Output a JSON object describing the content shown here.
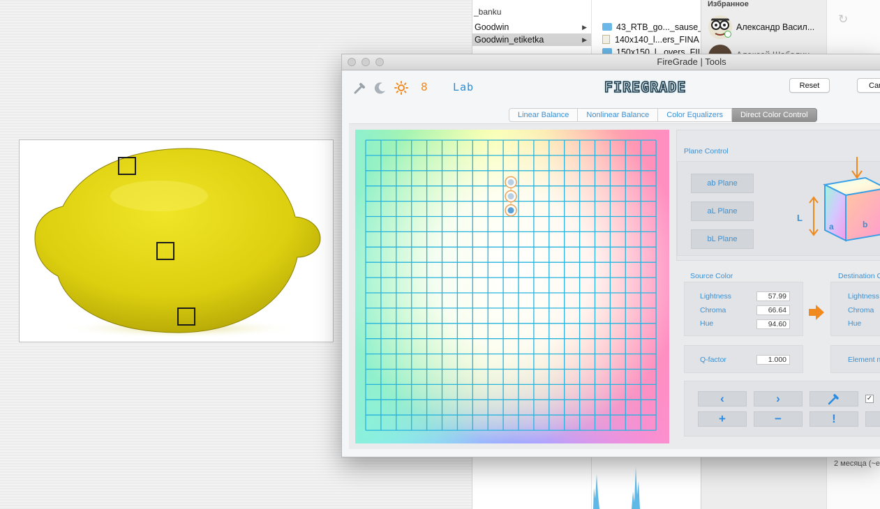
{
  "desktop": {
    "sample_markers": 3
  },
  "finder": {
    "path_fragment": "_banku",
    "folders": [
      {
        "label": "Goodwin",
        "selected": false
      },
      {
        "label": "Goodwin_etiketka",
        "selected": true
      }
    ],
    "files": [
      {
        "label": "43_RTB_go..._sause_p",
        "icon": "folder-icon"
      },
      {
        "label": "140x140_l...ers_FINA",
        "icon": "document-icon"
      },
      {
        "label": "150x150_l...overs_FII",
        "icon": "folder-icon"
      }
    ]
  },
  "contacts": {
    "header": "Избранное",
    "items": [
      {
        "name": "Александр Васил..."
      },
      {
        "name": "Алексей Шабалин"
      }
    ],
    "date_text": "2 месяца (~е"
  },
  "window": {
    "title": "FireGrade | Tools",
    "toolbar": {
      "mode_number": "8",
      "color_space": "Lab",
      "logo_text": "FIREGRADE",
      "reset_label": "Reset",
      "cancel_label": "Car"
    },
    "tabs": [
      {
        "label": "Linear Balance",
        "active": false
      },
      {
        "label": "Nonlinear Balance",
        "active": false
      },
      {
        "label": "Color Equalizers",
        "active": false
      },
      {
        "label": "Direct Color Control",
        "active": true
      }
    ],
    "grid": {
      "points": [
        {
          "col": 9.5,
          "row": 2.5
        },
        {
          "col": 9.5,
          "row": 3.5
        },
        {
          "col": 9.5,
          "row": 4.5
        }
      ]
    },
    "plane_control": {
      "title": "Plane Control",
      "buttons": [
        "ab Plane",
        "aL Plane",
        "bL Plane"
      ],
      "cube": {
        "label_l": "L",
        "label_a": "a",
        "label_b": "b"
      }
    },
    "source_color": {
      "title": "Source Color",
      "lightness_label": "Lightness",
      "lightness": "57.99",
      "chroma_label": "Chroma",
      "chroma": "66.64",
      "hue_label": "Hue",
      "hue": "94.60"
    },
    "destination_color": {
      "title": "Destination C",
      "lightness_label": "Lightness",
      "chroma_label": "Chroma",
      "hue_label": "Hue"
    },
    "q_factor": {
      "label": "Q-factor",
      "value": "1.000"
    },
    "element_label": "Element n",
    "nav": {
      "prev": "‹",
      "next": "›",
      "add": "+",
      "remove": "−",
      "alert": "!",
      "checked": "✓"
    },
    "colors": {
      "accent": "#3c8fd0",
      "orange": "#f08a1f",
      "grid_line": "#26b3de"
    }
  }
}
